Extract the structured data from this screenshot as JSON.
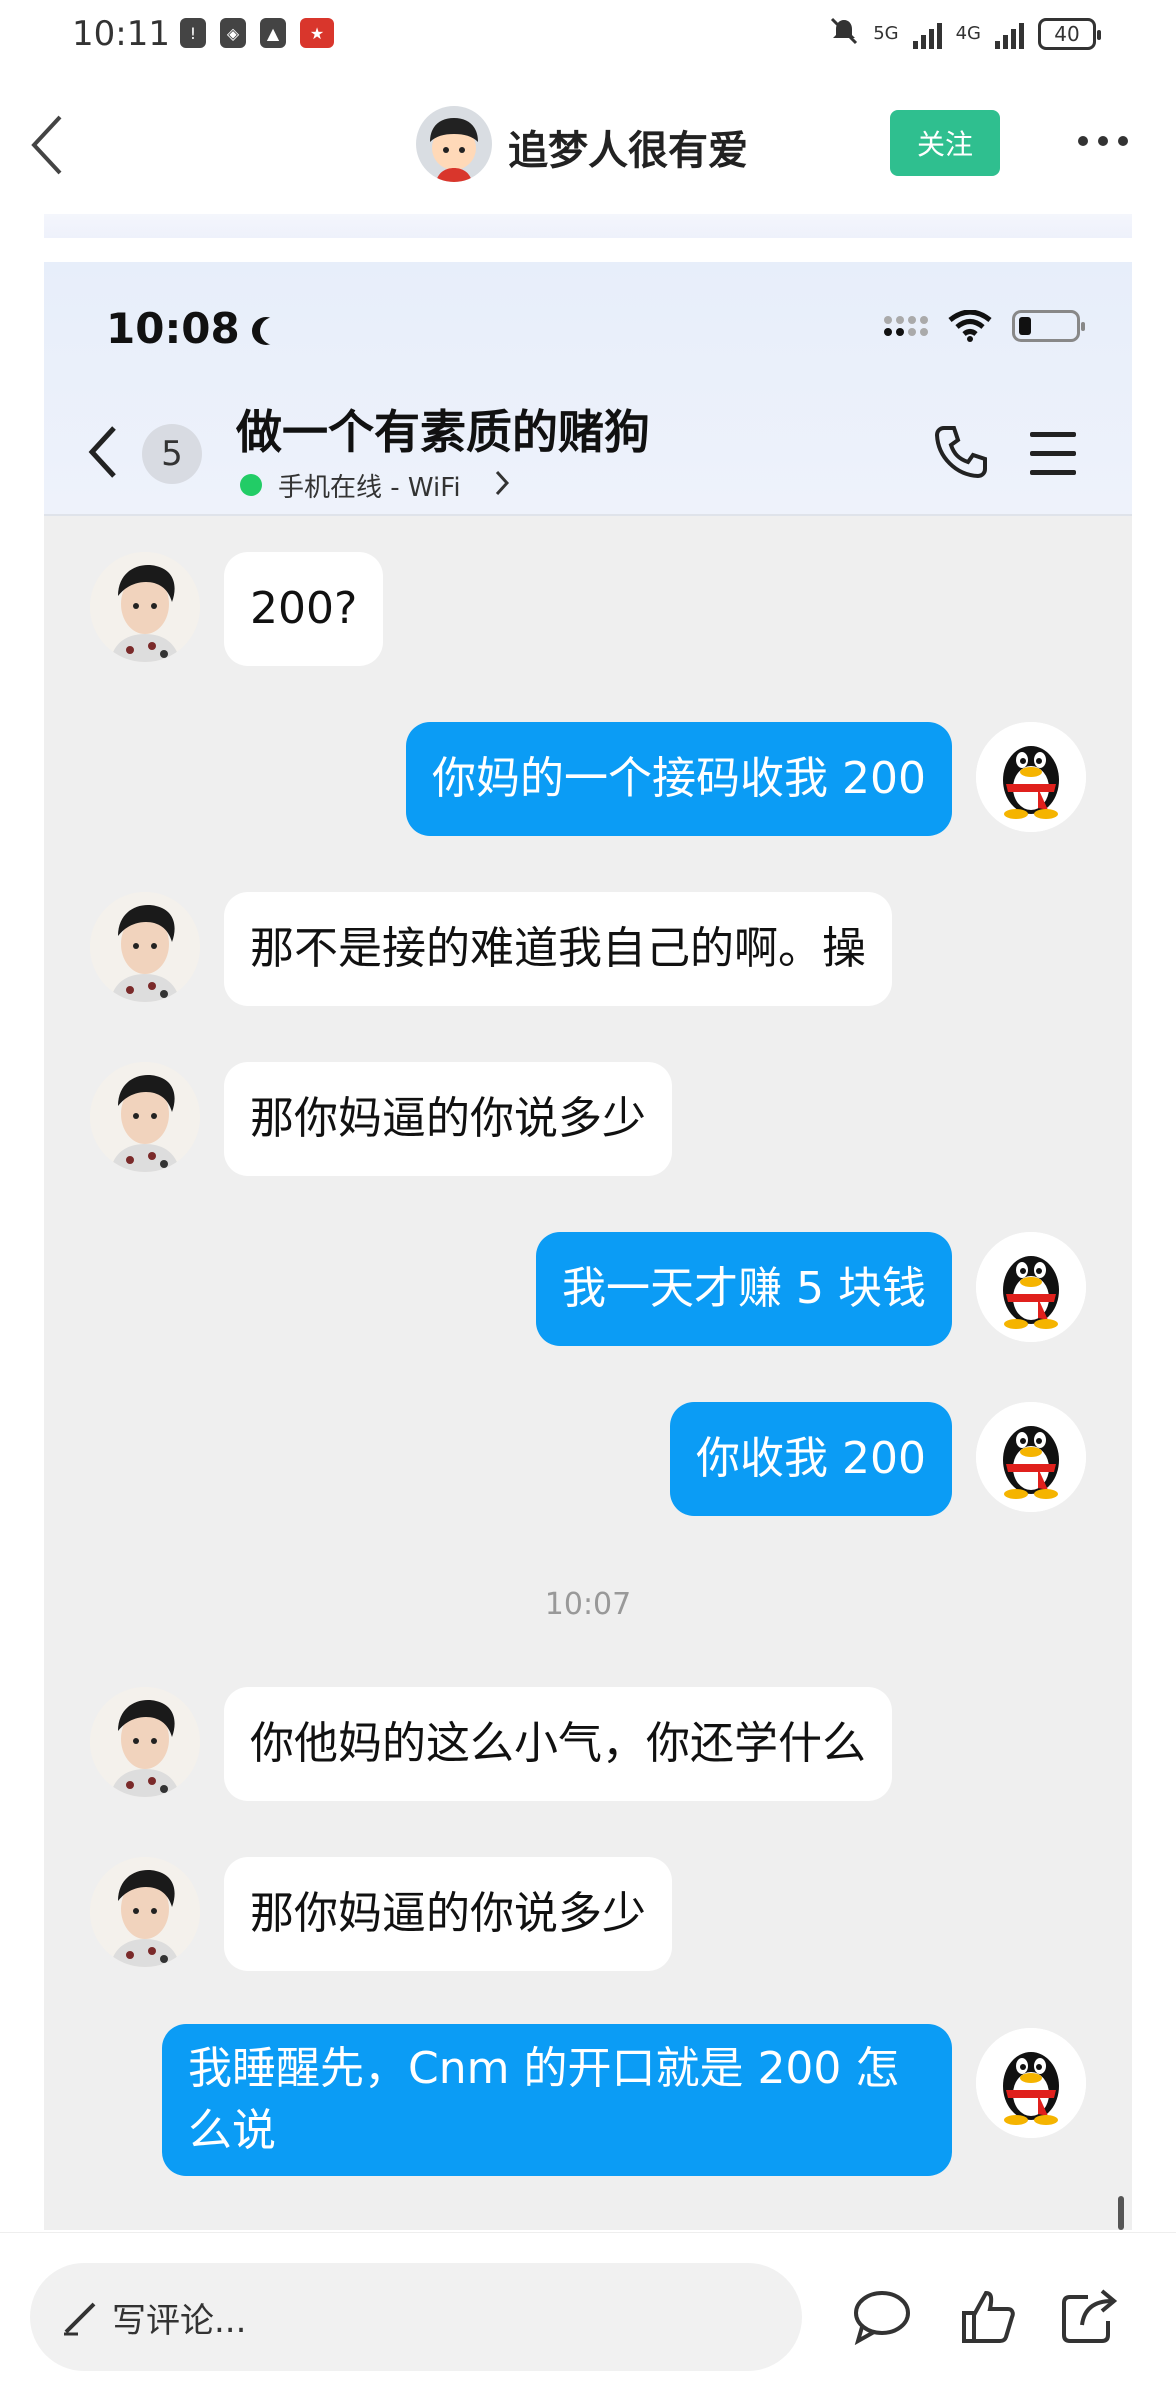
{
  "status_bar": {
    "time": "10:11",
    "net1": "5G",
    "net2": "4G",
    "battery": "40"
  },
  "header": {
    "author": "追梦人很有爱",
    "follow_label": "关注"
  },
  "screenshot": {
    "status": {
      "time": "10:08"
    },
    "chat": {
      "unread_count": "5",
      "title": "做一个有素质的赌狗",
      "subtitle": "手机在线 - WiFi"
    },
    "messages": [
      {
        "side": "in",
        "text": "200?"
      },
      {
        "side": "out",
        "text": "你妈的一个接码收我 200"
      },
      {
        "side": "in",
        "text": "那不是接的难道我自己的啊。操"
      },
      {
        "side": "in",
        "text": "那你妈逼的你说多少"
      },
      {
        "side": "out",
        "text": "我一天才赚 5 块钱"
      },
      {
        "side": "out",
        "text": "你收我 200"
      },
      {
        "side": "time",
        "text": "10:07"
      },
      {
        "side": "in",
        "text": "你他妈的这么小气，你还学什么"
      },
      {
        "side": "in",
        "text": "那你妈逼的你说多少"
      },
      {
        "side": "out",
        "text": "我睡醒先，Cnm 的开口就是 200 怎么说"
      }
    ]
  },
  "bottom": {
    "comment_placeholder": "写评论..."
  },
  "colors": {
    "out_bubble": "#0b9cf5",
    "follow": "#2fbf8f",
    "online": "#22cc66"
  }
}
